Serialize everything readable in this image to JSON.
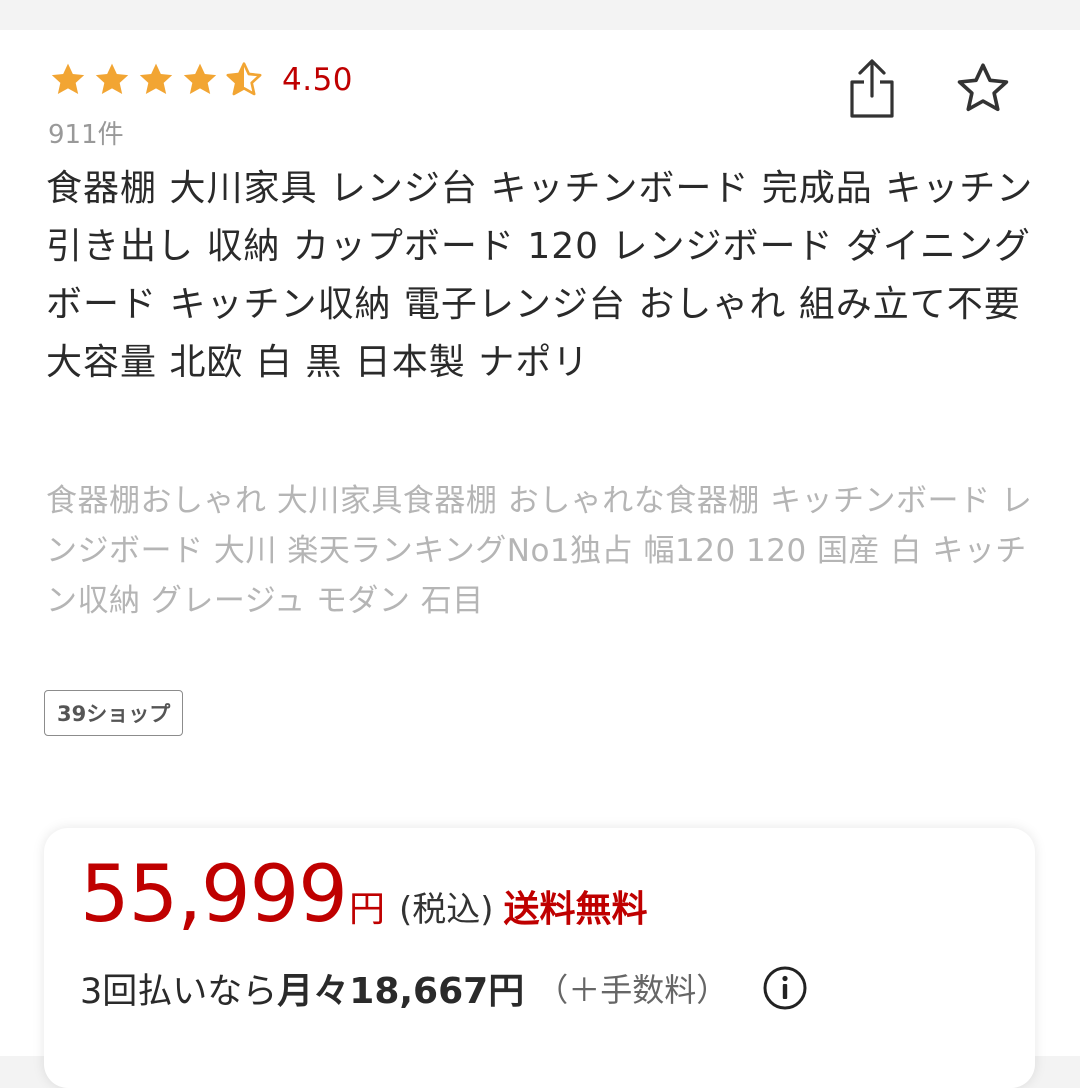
{
  "product": {
    "rating": {
      "value": "4.50",
      "stars": 4.5,
      "star_color": "#f2a533",
      "count": "911件"
    },
    "title": "食器棚 大川家具 レンジ台 キッチンボード 完成品 キッチン 引き出し 収納 カップボード 120 レンジボード ダイニングボード キッチン収納 電子レンジ台 おしゃれ 組み立て不要 大容量 北欧 白 黒 日本製 ナポリ",
    "catch_copy": "食器棚おしゃれ 大川家具食器棚 おしゃれな食器棚 キッチンボード レンジボード 大川 楽天ランキングNo1独占 幅120 120 国産 白 キッチン収納 グレージュ モダン 石目",
    "shop_badge": "39ショップ",
    "icons": {
      "share": "share-icon",
      "favorite": "star-outline-icon",
      "info": "info-icon"
    }
  },
  "price": {
    "amount": "55,999",
    "yen": "円",
    "tax": "(税込)",
    "shipping": "送料無料",
    "installment_prefix": "3回払いなら",
    "installment_amount": "月々18,667円",
    "installment_fee": "（＋手数料）",
    "accent_color": "#bf0000"
  }
}
